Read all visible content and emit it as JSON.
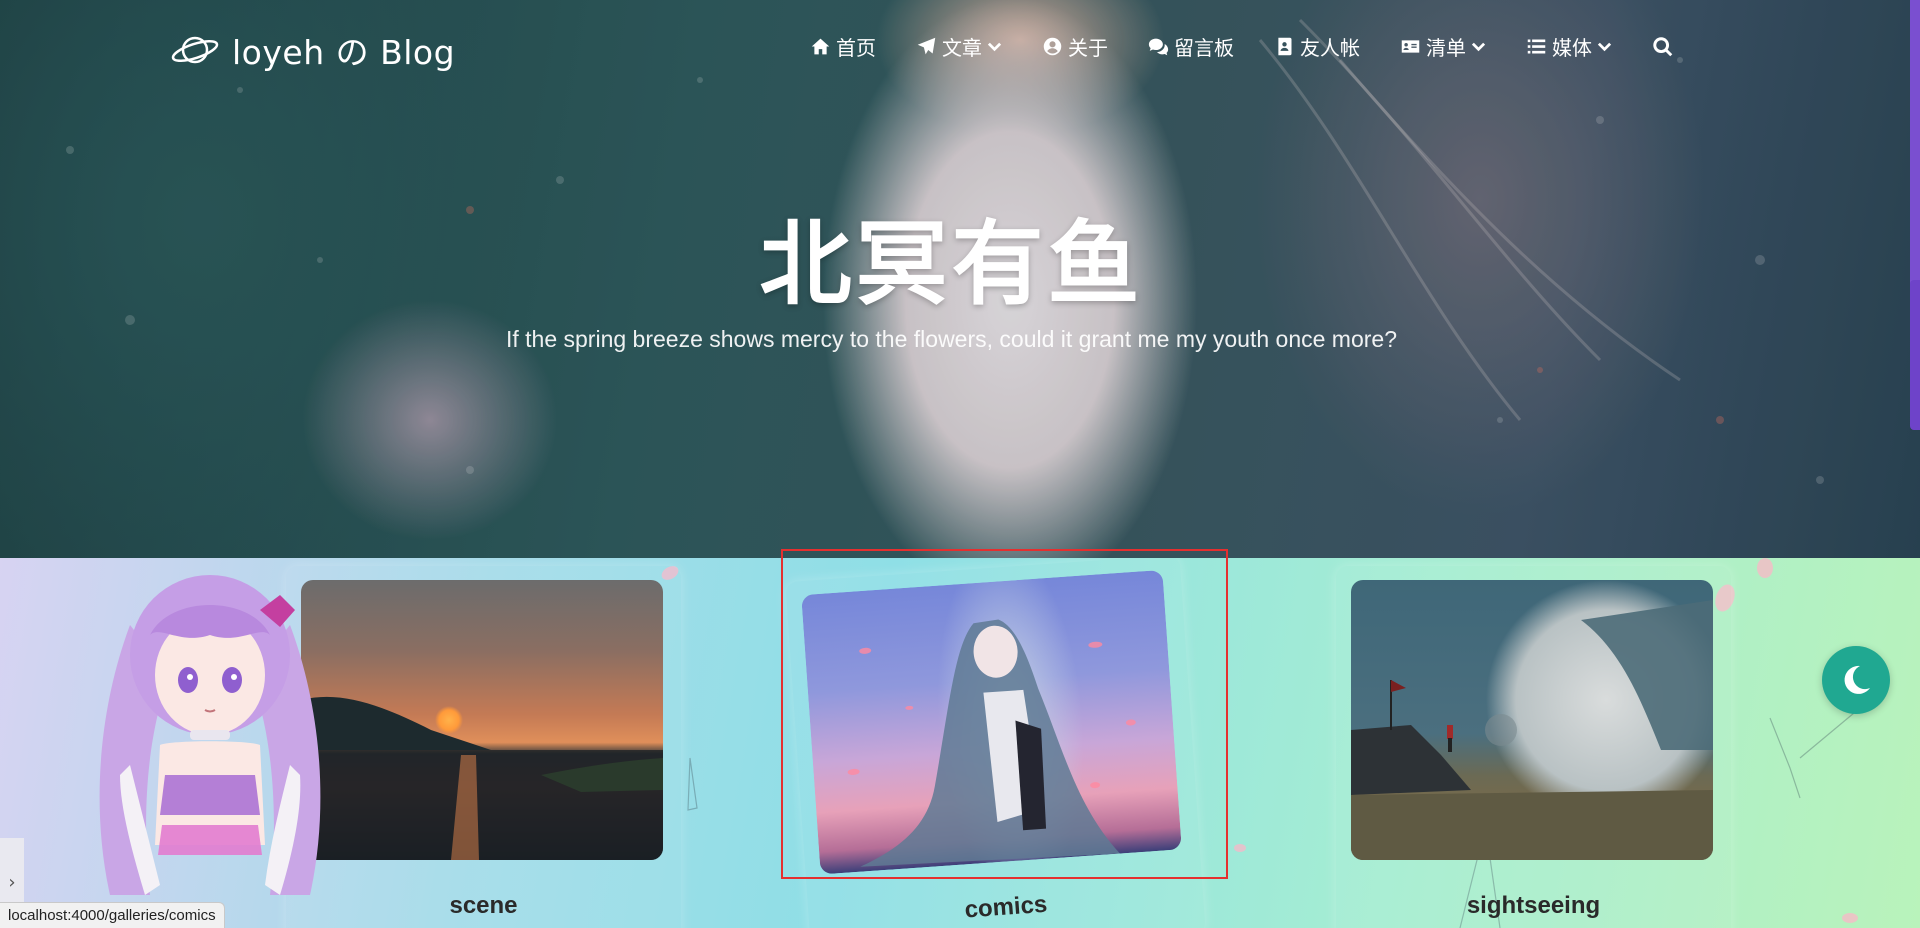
{
  "site": {
    "title": "loyeh の Blog",
    "logo_icon": "planet-icon"
  },
  "nav": {
    "items": [
      {
        "label": "首页",
        "icon": "home-icon",
        "dropdown": false
      },
      {
        "label": "文章",
        "icon": "paper-plane-icon",
        "dropdown": true
      },
      {
        "label": "关于",
        "icon": "user-circle-icon",
        "dropdown": false
      },
      {
        "label": "留言板",
        "icon": "comments-icon",
        "dropdown": false
      },
      {
        "label": "友人帐",
        "icon": "address-book-icon",
        "dropdown": false
      },
      {
        "label": "清单",
        "icon": "id-card-icon",
        "dropdown": true
      },
      {
        "label": "媒体",
        "icon": "list-icon",
        "dropdown": true
      }
    ],
    "search_icon": "search-icon"
  },
  "hero": {
    "title": "北冥有鱼",
    "subtitle": "If the spring breeze shows mercy to the flowers, could it grant me my youth once more?"
  },
  "gallery": {
    "cards": [
      {
        "label": "scene"
      },
      {
        "label": "comics"
      },
      {
        "label": "sightseeing"
      }
    ]
  },
  "theme_toggle": {
    "icon": "moon-icon"
  },
  "side_panel": {
    "icon": "chevron-right-icon",
    "glyph": "›"
  },
  "status_bar": {
    "url": "localhost:4000/galleries/comics"
  },
  "colors": {
    "accent_toggle": "#20a891",
    "highlight": "#e52f2f",
    "scroll_accent": "#7a4fd0"
  }
}
